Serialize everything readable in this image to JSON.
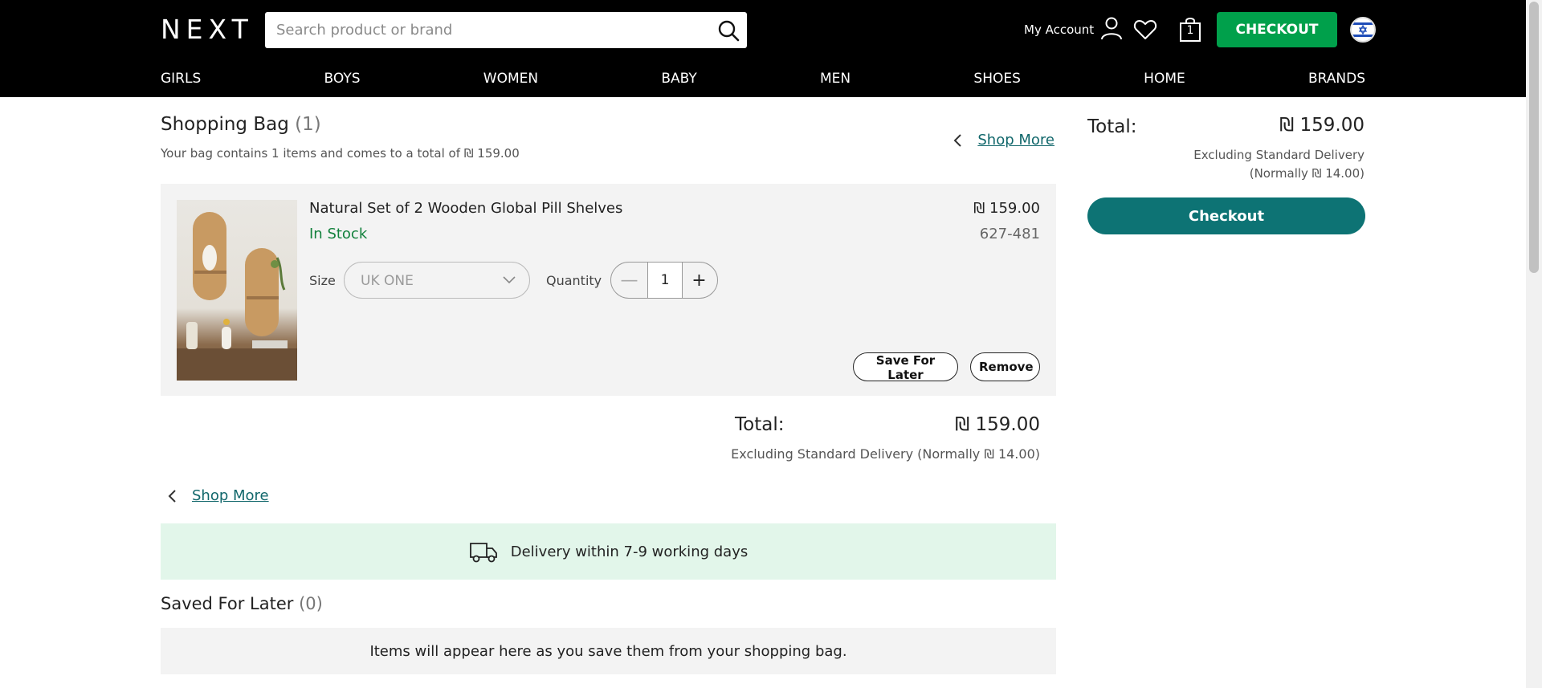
{
  "header": {
    "logo": "NEXT",
    "search_placeholder": "Search product or brand",
    "account_label": "My Account",
    "bag_count": "1",
    "checkout_label": "CHECKOUT",
    "nav": [
      "GIRLS",
      "BOYS",
      "WOMEN",
      "BABY",
      "MEN",
      "SHOES",
      "HOME",
      "BRANDS"
    ]
  },
  "bag": {
    "title": "Shopping Bag",
    "count": "(1)",
    "summary": "Your bag contains 1 items and comes to a total of ₪ 159.00",
    "shop_more": "Shop More"
  },
  "item": {
    "name": "Natural Set of 2 Wooden Global Pill Shelves",
    "stock": "In Stock",
    "price": "₪ 159.00",
    "code": "627-481",
    "size_label": "Size",
    "size_value": "UK ONE",
    "quantity_label": "Quantity",
    "quantity": "1",
    "minus": "—",
    "plus": "+",
    "save_label": "Save For Later",
    "remove_label": "Remove"
  },
  "totals": {
    "label": "Total:",
    "value": "₪ 159.00",
    "note": "Excluding Standard Delivery (Normally ₪ 14.00)"
  },
  "summary": {
    "label": "Total:",
    "value": "₪ 159.00",
    "note_line1": "Excluding Standard Delivery",
    "note_line2": "(Normally ₪ 14.00)",
    "checkout_label": "Checkout"
  },
  "delivery": {
    "text": "Delivery within 7-9 working days"
  },
  "saved": {
    "title": "Saved For Later",
    "count": "(0)",
    "empty_text": "Items will appear here as you save them from your shopping bag."
  },
  "colors": {
    "header_bg": "#000000",
    "checkout_green": "#00a04b",
    "checkout_teal": "#0d7374",
    "stock_green": "#12813c",
    "link_teal": "#11676b",
    "delivery_bg": "#e2f6ea"
  }
}
